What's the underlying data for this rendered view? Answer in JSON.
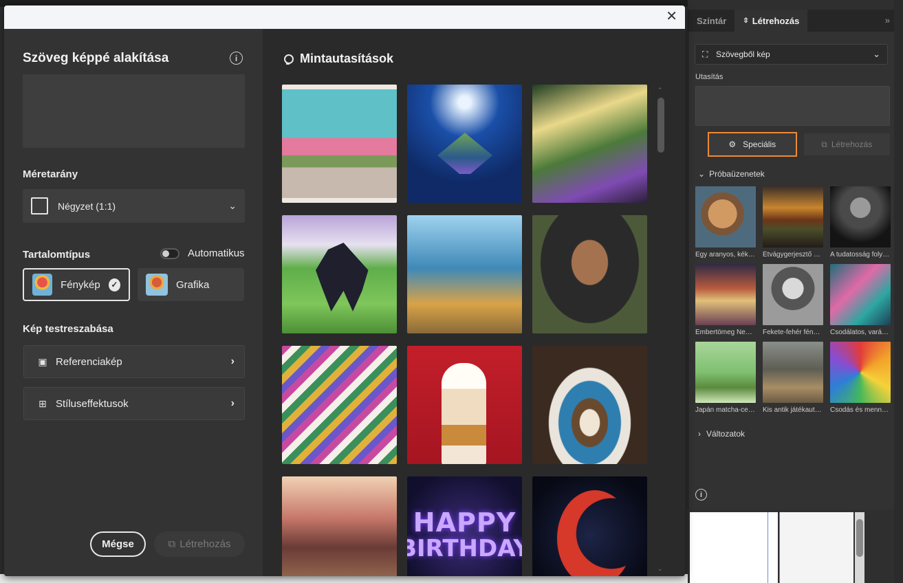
{
  "modal": {
    "close_icon": "close-icon",
    "title": "Szöveg képpé alakítása",
    "aspect_ratio": {
      "heading": "Méretarány",
      "selected": "Négyzet (1:1)"
    },
    "content_type": {
      "heading": "Tartalomtípus",
      "auto_label": "Automatikus",
      "auto_on": false,
      "options": [
        "Fénykép",
        "Grafika"
      ],
      "selected": "Fénykép"
    },
    "customize": {
      "heading": "Kép testreszabása",
      "reference_label": "Referenciakép",
      "style_label": "Stíluseffektusok"
    },
    "cancel_label": "Mégse",
    "create_label": "Létrehozás",
    "samples_title": "Mintautasítások",
    "sample_images": [
      "city-street",
      "floating-island",
      "enchanted-forest",
      "unicorn",
      "giraffes-city",
      "portrait-man",
      "peacock-feathers",
      "milkshake",
      "latte",
      "golden-gate-woman",
      "happy-birthday-balloons",
      "yarn-moon"
    ],
    "birthday_text": {
      "line1": "HAPPY",
      "line2": "BIRTHDAY"
    }
  },
  "panel": {
    "tabs": [
      "Színtár",
      "Létrehozás"
    ],
    "active_tab": "Létrehozás",
    "mode_select": "Szövegből kép",
    "prompt_label": "Utasítás",
    "special_button": "Speciális",
    "create_button": "Létrehozás",
    "samples_heading": "Próbaüzenetek",
    "samples": [
      {
        "caption": "Egy aranyos, kék…"
      },
      {
        "caption": "Étvágygerjesztő h…"
      },
      {
        "caption": "A tudatosság foly…"
      },
      {
        "caption": "Embertömeg Ne…"
      },
      {
        "caption": "Fekete-fehér fény…"
      },
      {
        "caption": "Csodálatos, varáz…"
      },
      {
        "caption": "Japán matcha-cer…"
      },
      {
        "caption": "Kis antik játékaut…"
      },
      {
        "caption": "Csodás és menny…"
      }
    ],
    "variants_heading": "Változatok"
  },
  "colors": {
    "highlight": "#ef8a34",
    "modal_bg": "#2c2c2c",
    "panel_bg": "#323232"
  }
}
